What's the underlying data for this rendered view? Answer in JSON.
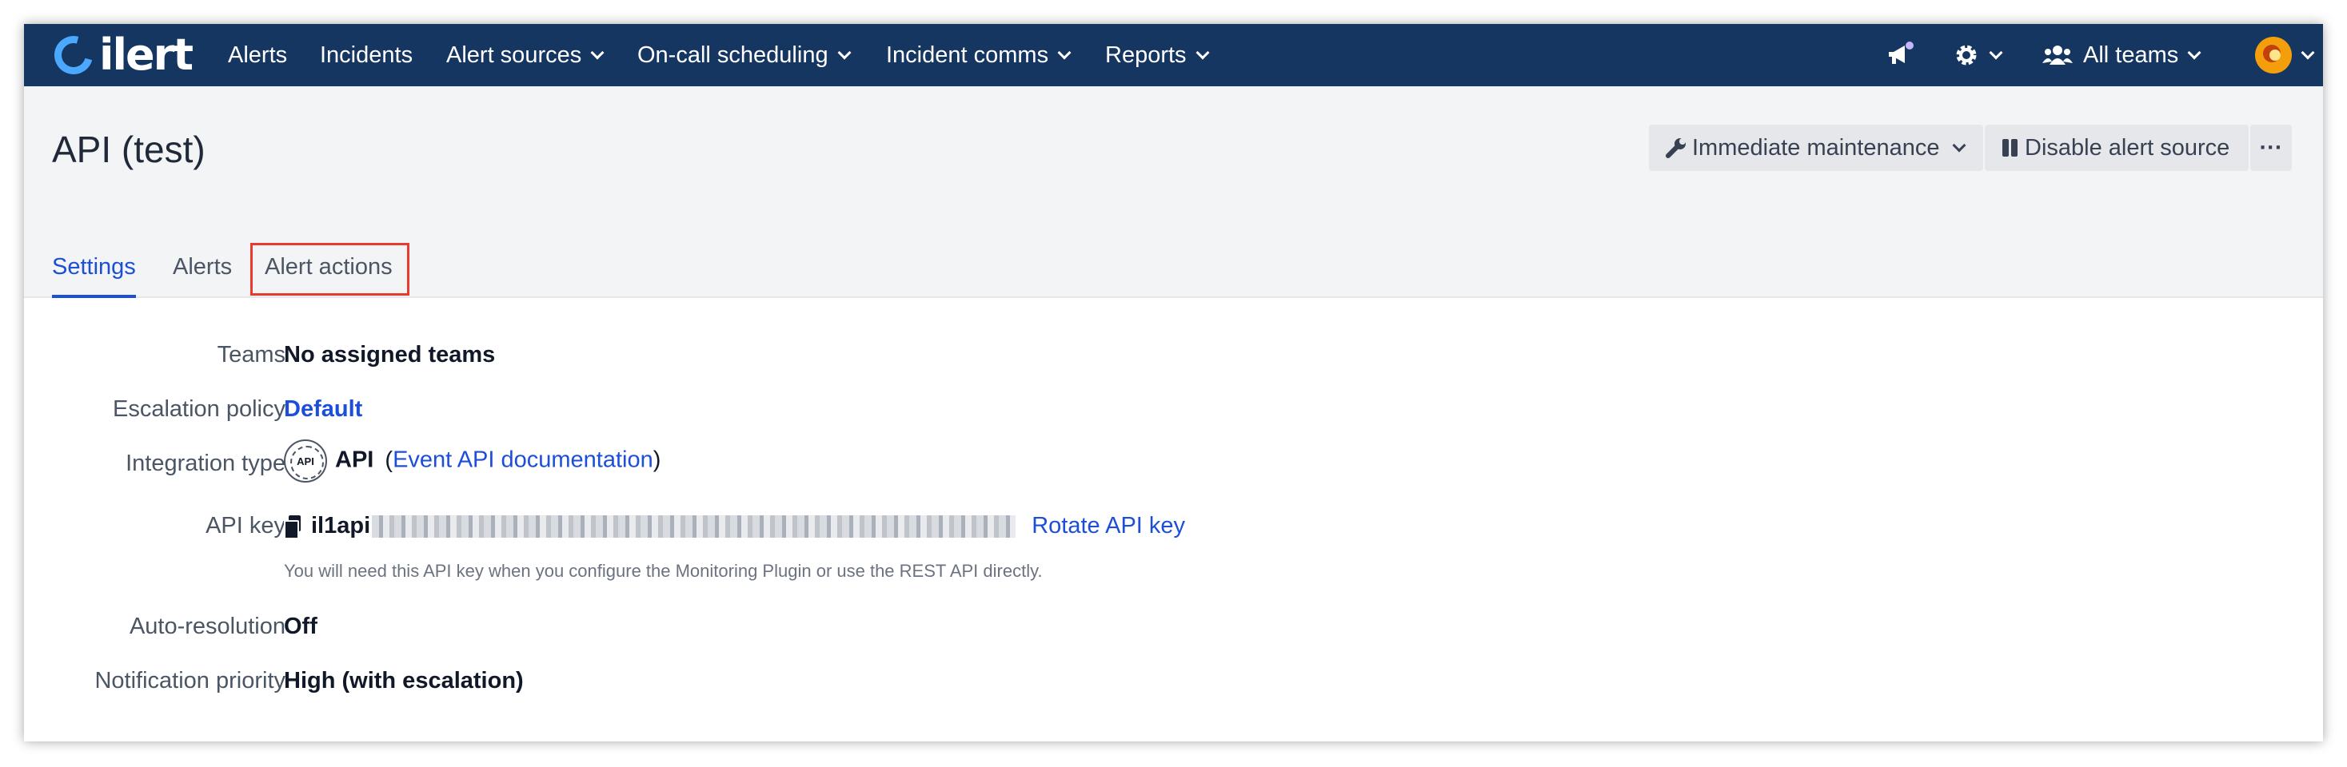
{
  "app": {
    "logo_text": "ilert"
  },
  "nav": {
    "items": [
      {
        "label": "Alerts"
      },
      {
        "label": "Incidents"
      },
      {
        "label": "Alert sources"
      },
      {
        "label": "On-call scheduling"
      },
      {
        "label": "Incident comms"
      },
      {
        "label": "Reports"
      }
    ],
    "teams_label": "All teams",
    "icons": [
      "megaphone-icon",
      "gear-icon",
      "users-icon",
      "avatar"
    ]
  },
  "page": {
    "title": "API (test)",
    "buttons": {
      "maintenance": "Immediate maintenance",
      "disable": "Disable alert source",
      "more": "···"
    },
    "tabs": [
      {
        "label": "Settings",
        "active": true
      },
      {
        "label": "Alerts",
        "active": false
      },
      {
        "label": "Alert actions",
        "active": false,
        "highlighted": true
      }
    ]
  },
  "details": {
    "teams": {
      "label": "Teams",
      "value": "No assigned teams"
    },
    "escalation": {
      "label": "Escalation policy",
      "value": "Default"
    },
    "integration": {
      "label": "Integration type",
      "badge": "API",
      "value": "API",
      "open_paren": "(",
      "link": "Event API documentation",
      "close_paren": ")"
    },
    "api_key": {
      "label": "API key",
      "prefix": "il1api",
      "rotate_link": "Rotate API key",
      "help": "You will need this API key when you configure the Monitoring Plugin or use the REST API directly."
    },
    "auto_resolution": {
      "label": "Auto-resolution",
      "value": "Off"
    },
    "priority": {
      "label": "Notification priority",
      "value": "High (with escalation)"
    }
  },
  "colors": {
    "nav_bg": "#163662",
    "accent": "#1d4ed8",
    "highlight": "#e63b2e",
    "header_bg": "#f3f4f6"
  }
}
